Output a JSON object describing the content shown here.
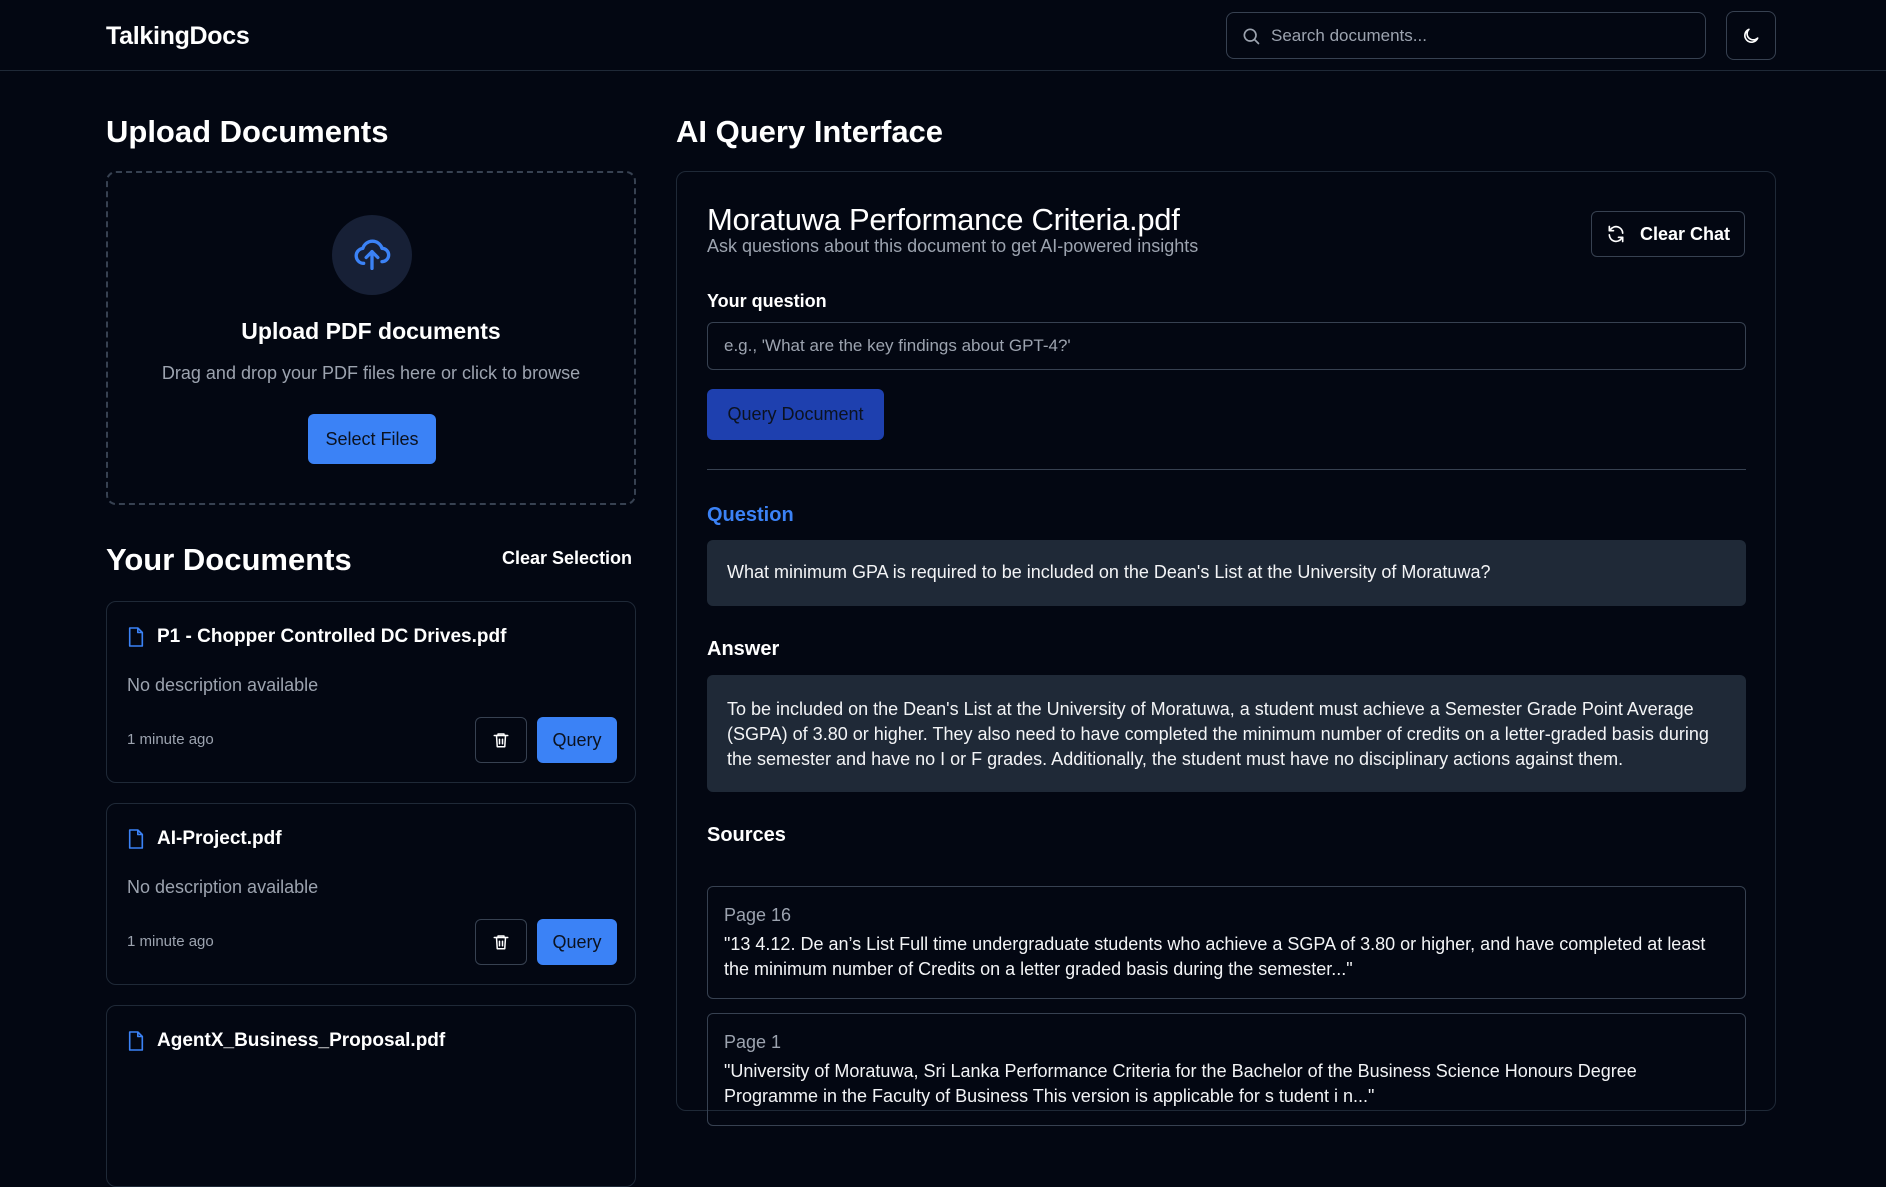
{
  "header": {
    "brand": "TalkingDocs",
    "search_placeholder": "Search documents..."
  },
  "upload": {
    "section_title": "Upload Documents",
    "title": "Upload PDF documents",
    "subtitle": "Drag and drop your PDF files here or click to browse",
    "select_button": "Select Files"
  },
  "documents": {
    "section_title": "Your Documents",
    "clear_selection": "Clear Selection",
    "items": [
      {
        "name": "P1 - Chopper Controlled DC Drives.pdf",
        "description": "No description available",
        "time": "1 minute ago",
        "query_label": "Query"
      },
      {
        "name": "AI-Project.pdf",
        "description": "No description available",
        "time": "1 minute ago",
        "query_label": "Query"
      },
      {
        "name": "AgentX_Business_Proposal.pdf",
        "description": "",
        "time": "",
        "query_label": ""
      }
    ]
  },
  "query": {
    "section_title": "AI Query Interface",
    "doc_title": "Moratuwa Performance Criteria.pdf",
    "doc_subtitle": "Ask questions about this document to get AI-powered insights",
    "clear_chat": "Clear Chat",
    "question_label": "Your question",
    "question_placeholder": "e.g., 'What are the key findings about GPT-4?'",
    "query_button": "Query Document",
    "question_heading": "Question",
    "question_text": "What minimum GPA is required to be included on the Dean's List at the University of Moratuwa?",
    "answer_heading": "Answer",
    "answer_text": "To be included on the Dean's List at the University of Moratuwa, a student must achieve a Semester Grade Point Average (SGPA) of 3.80 or higher. They also need to have completed the minimum number of credits on a letter-graded basis during the semester and have no I or F grades. Additionally, the student must have no disciplinary actions against them.",
    "sources_heading": "Sources",
    "sources": [
      {
        "page": "Page 16",
        "text": "\"13 4.12. De an’s List Full time undergraduate students who achieve a SGPA of 3.80 or higher, and have completed at least the minimum number of Credits on a letter graded basis during the semester...\""
      },
      {
        "page": "Page 1",
        "text": "\"University of Moratuwa, Sri Lanka Performance Criteria for the Bachelor of the Business Science Honours Degree Programme in the Faculty of Business This version is applicable for s tudent i n...\""
      }
    ]
  },
  "colors": {
    "accent": "#3b82f6",
    "background": "#030712",
    "card": "#1f2937",
    "border": "#374151",
    "muted": "#9ca3af"
  }
}
